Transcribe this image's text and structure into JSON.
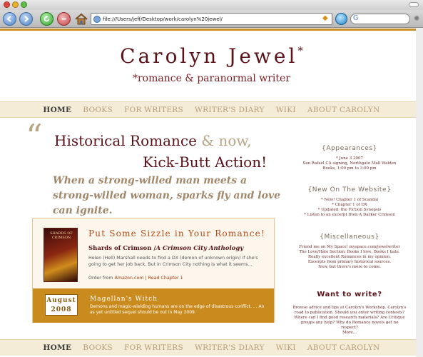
{
  "browser": {
    "url": "file:///Users/jeff/Desktop/work/carolyn%20jewel/",
    "search_glyph": "G"
  },
  "site": {
    "title": "Carolyn Jewel",
    "title_star": "*",
    "tagline": "*romance & paranormal writer"
  },
  "nav": {
    "items": [
      {
        "label": "HOME",
        "active": true
      },
      {
        "label": "BOOKS"
      },
      {
        "label": "FOR WRITERS"
      },
      {
        "label": "WRITER'S DIARY"
      },
      {
        "label": "WIKI"
      },
      {
        "label": "ABOUT CAROLYN"
      }
    ]
  },
  "hero": {
    "quote": "“",
    "line1_a": "Historical Romance",
    "line1_b": "& now,",
    "line2": "Kick-Butt Action!",
    "sub": "When a strong-willed man meets a strong-willed woman, sparks fly and love can ignite."
  },
  "feature": {
    "cover_text": "SHARDS OF CRIMSON",
    "heading": "Put Some Sizzle in Your Romance!",
    "book_title": "Shards of Crimson",
    "book_anthology": "A Crimson City Anthology",
    "description": "Helen (Hell) Marshall needs to find a DX (demon of unknown origin) if she's going to get her job back. But in Crimson City nothing is what it seems...",
    "order_prefix": "Order from",
    "order_link": "Amazon.com",
    "separator": "|",
    "read_link": "Read Chapter 1"
  },
  "coming": {
    "month": "August",
    "year": "2008",
    "title": "Magellan's Witch",
    "description": "Demons and magic-wielding humans are on the edge of disastrous conflict. . . An as yet untitled sequel should be out in May 2009."
  },
  "sidebar": {
    "appearances_head": "{Appearances}",
    "appearances_lines": [
      "* June 3 2007",
      "San Rafael CA signing, Northgate Mall Walden",
      "Books, 1:00 pm to 3:00 pm"
    ],
    "new_head": "{New On The Website}",
    "new_lines": [
      "* New! Chapter 1 of Scandal",
      "* Chapter 1 of DX",
      "* Updated: the Fiction Synopsis",
      "* Listen to an excerpt from A Darker Crimson"
    ],
    "misc_head": "{Miscellaneous}",
    "misc_lines": [
      "Friend me on My Space! myspace.com/jewelwriter",
      "The Love/Hate Section: Books I love, Books I hate.",
      "Really excellent Romances in my opinion.",
      "Excerpts from primary historical sources.",
      "New, but there's more to come."
    ],
    "want_head": "Want to write?",
    "want_lines": [
      "Browse advice and tips at Carolyn's Workshop. Carolyn's",
      "road to publication. Should you enter writing contests?",
      "Where can I find good research materials? Are Critique",
      "groups any help? Why do Romance novels get no respect?",
      "More..."
    ]
  },
  "colors": {
    "accent_gold": "#c98b1e",
    "title_maroon": "#5b1319",
    "nav_bg": "#f5ecd8"
  }
}
